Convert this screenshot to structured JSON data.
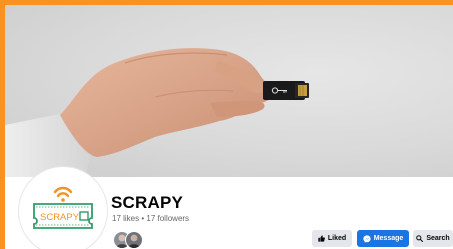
{
  "page": {
    "name": "SCRAPY",
    "stats": "17 likes • 17 followers",
    "avatar_logo_text": "SCRAPY"
  },
  "buttons": {
    "liked_label": "Liked",
    "message_label": "Message",
    "search_label": "Search"
  },
  "colors": {
    "frame_orange": "#f8931f",
    "logo_green": "#2e9e6a",
    "logo_orange": "#f39224",
    "message_blue": "#1b74e4"
  },
  "icons": {
    "liked": "thumbs-up-icon",
    "message": "messenger-icon",
    "search": "search-icon"
  }
}
